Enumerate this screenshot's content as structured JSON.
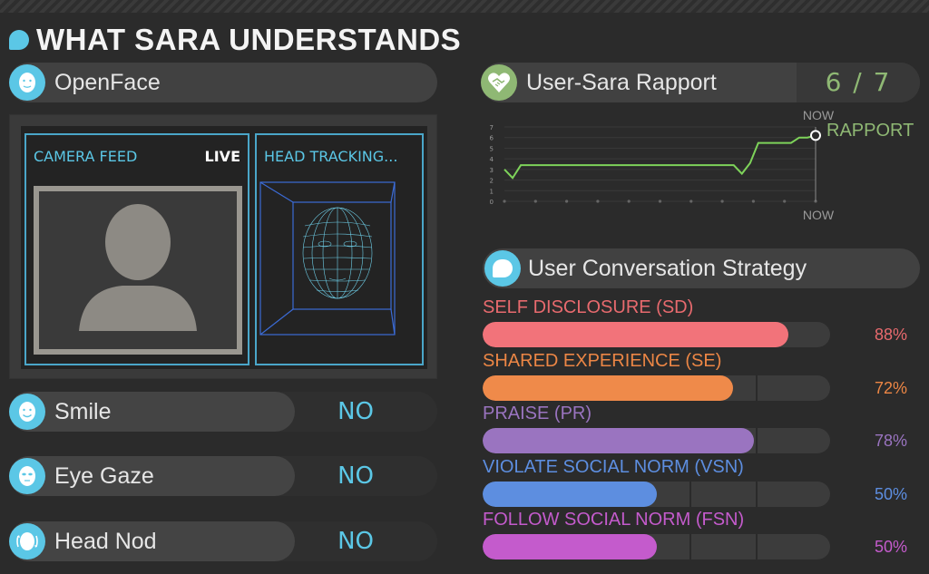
{
  "title": "WHAT SARA UNDERSTANDS",
  "openface": {
    "label": "OpenFace",
    "camera_label": "CAMERA FEED",
    "live_label": "LIVE",
    "head_tracking_label": "HEAD TRACKING..."
  },
  "detections": [
    {
      "label": "Smile",
      "value": "NO",
      "icon": "smile-face-icon"
    },
    {
      "label": "Eye Gaze",
      "value": "NO",
      "icon": "eye-gaze-face-icon"
    },
    {
      "label": "Head Nod",
      "value": "NO",
      "icon": "head-nod-icon"
    }
  ],
  "rapport": {
    "label": "User-Sara Rapport",
    "value": "6 / 7",
    "chart_top_label": "NOW",
    "chart_bottom_label": "NOW",
    "series_label": "RAPPORT",
    "color": "#8fb874"
  },
  "chart_data": {
    "type": "line",
    "ylim": [
      0,
      7
    ],
    "y_ticks": [
      "0",
      "1",
      "2",
      "3",
      "4",
      "5",
      "6",
      "7"
    ],
    "series": [
      {
        "name": "RAPPORT",
        "values": [
          3,
          2.2,
          3.4,
          3.4,
          3.4,
          3.4,
          3.4,
          3.4,
          3.4,
          3.4,
          3.4,
          3.4,
          3.4,
          3.4,
          3.4,
          3.4,
          3.4,
          3.4,
          3.4,
          3.4,
          3.4,
          3.4,
          3.4,
          3.4,
          3.4,
          3.4,
          3.4,
          3.4,
          3.4,
          2.6,
          3.6,
          5.5,
          5.5,
          5.5,
          5.5,
          5.5,
          6.0,
          6.0,
          6.2
        ]
      }
    ],
    "grid": true
  },
  "strategy": {
    "label": "User Conversation Strategy",
    "items": [
      {
        "label": "SELF DISCLOSURE (SD)",
        "percent": "88%",
        "value": 0.88,
        "color": "#f2737a",
        "label_color": "#e86a6e"
      },
      {
        "label": "SHARED EXPERIENCE (SE)",
        "percent": "72%",
        "value": 0.72,
        "color": "#ef8a4a",
        "label_color": "#ec8645"
      },
      {
        "label": "PRAISE (PR)",
        "percent": "78%",
        "value": 0.78,
        "color": "#9a74c0",
        "label_color": "#9a74c0"
      },
      {
        "label": "VIOLATE SOCIAL NORM (VSN)",
        "percent": "50%",
        "value": 0.5,
        "color": "#5d8ee0",
        "label_color": "#5d8ee0"
      },
      {
        "label": "FOLLOW SOCIAL NORM (FSN)",
        "percent": "50%",
        "value": 0.5,
        "color": "#c45bcc",
        "label_color": "#c45bcc"
      }
    ]
  }
}
